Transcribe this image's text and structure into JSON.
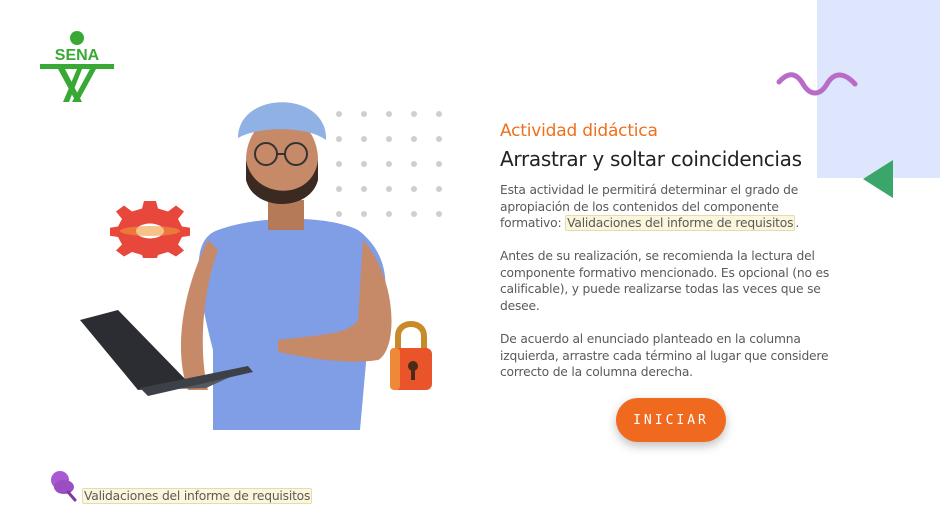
{
  "logo": {
    "text": "SENA"
  },
  "activity": {
    "eyebrow": "Actividad didáctica",
    "title": "Arrastrar y soltar coincidencias",
    "p1_text": "Esta actividad le permitirá determinar el grado de apropiación de los contenidos del componente formativo: ",
    "p1_link": "Validaciones del informe de requisitos",
    "p1_end": ".",
    "p2": "Antes de su realización, se recomienda la lectura del componente formativo mencionado.  Es opcional (no es calificable), y puede realizarse todas las veces que se desee.",
    "p3": "De acuerdo al enunciado planteado en la columna izquierda, arrastre cada término al lugar que considere correcto de la columna derecha.",
    "button_label": "INICIAR"
  },
  "footer": {
    "link": "Validaciones del informe de requisitos"
  },
  "colors": {
    "accent": "#ef6a1f",
    "logo_green": "#39a935",
    "panel": "#dde6fc",
    "wave": "#b86cc8",
    "triangle": "#3aa66a"
  },
  "icons": [
    "sena-logo-icon",
    "wave-icon",
    "triangle-icon",
    "gear-icon",
    "padlock-icon",
    "pin-icon"
  ]
}
